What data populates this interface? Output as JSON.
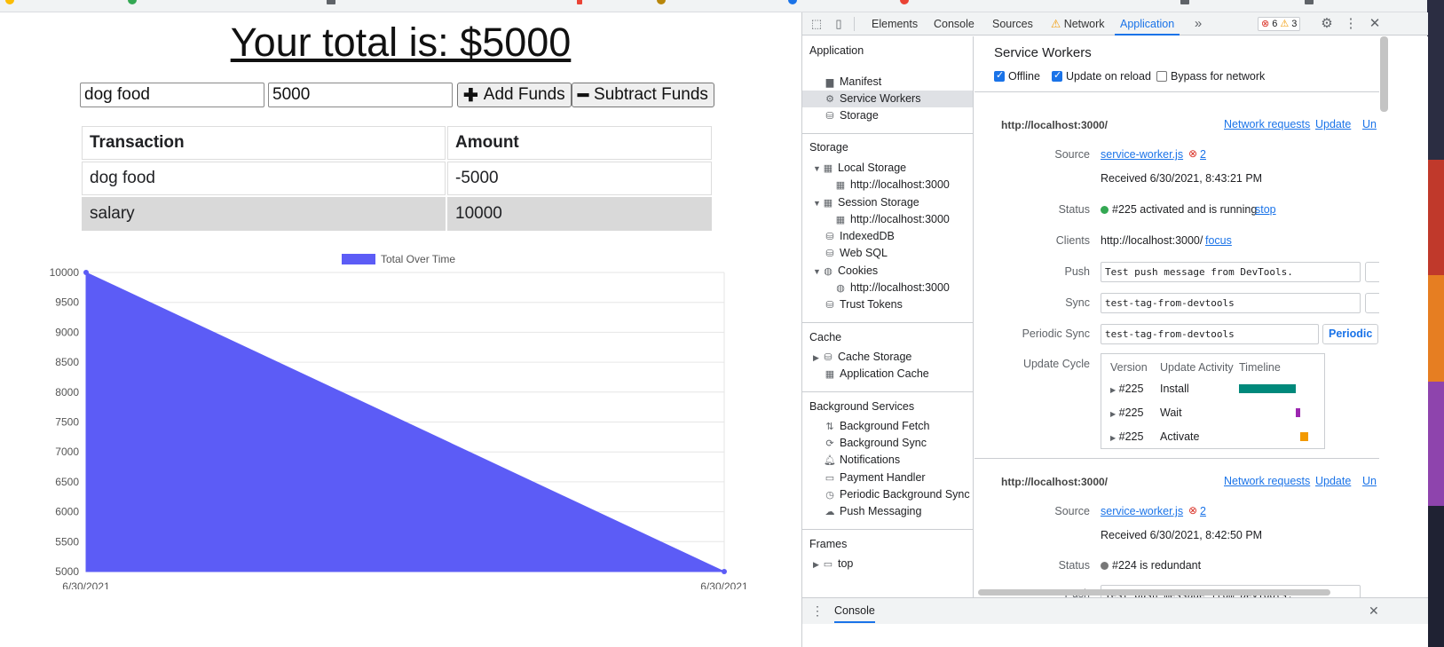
{
  "app": {
    "total_label": "Your total is: $5000",
    "name_input": "dog food",
    "amount_input": "5000",
    "add_button": "Add Funds",
    "subtract_button": "Subtract Funds",
    "table": {
      "headers": [
        "Transaction",
        "Amount"
      ],
      "rows": [
        {
          "name": "dog food",
          "amount": "-5000"
        },
        {
          "name": "salary",
          "amount": "10000"
        }
      ]
    }
  },
  "chart_data": {
    "type": "area",
    "legend": "Total Over Time",
    "legend_position": "top",
    "color": "#5c5cf6",
    "categories": [
      "6/30/2021",
      "6/30/2021"
    ],
    "values": [
      10000,
      5000
    ],
    "ylim": [
      5000,
      10000
    ],
    "yticks": [
      10000,
      9500,
      9000,
      8500,
      8000,
      7500,
      7000,
      6500,
      6000,
      5500,
      5000
    ],
    "grid": true
  },
  "devtools": {
    "tabs": [
      "Elements",
      "Console",
      "Sources",
      "Network",
      "Application"
    ],
    "active_tab": "Application",
    "error_count": "6",
    "warning_count": "3",
    "sidebar": {
      "application_header": "Application",
      "application_items": [
        "Manifest",
        "Service Workers",
        "Storage"
      ],
      "storage_header": "Storage",
      "local_storage": "Local Storage",
      "session_storage": "Session Storage",
      "localhost": "http://localhost:3000",
      "indexeddb": "IndexedDB",
      "websql": "Web SQL",
      "cookies": "Cookies",
      "trust_tokens": "Trust Tokens",
      "cache_header": "Cache",
      "cache_storage": "Cache Storage",
      "application_cache": "Application Cache",
      "bg_header": "Background Services",
      "bg_items": [
        "Background Fetch",
        "Background Sync",
        "Notifications",
        "Payment Handler",
        "Periodic Background Sync",
        "Push Messaging"
      ],
      "frames_header": "Frames",
      "frames_top": "top"
    },
    "sw": {
      "title": "Service Workers",
      "offline": "Offline",
      "update_on_reload": "Update on reload",
      "bypass": "Bypass for network",
      "origin": "http://localhost:3000/",
      "network_requests": "Network requests",
      "update": "Update",
      "unregister": "Un",
      "labels": {
        "source": "Source",
        "status": "Status",
        "clients": "Clients",
        "push": "Push",
        "sync": "Sync",
        "periodic_sync": "Periodic Sync",
        "update_cycle": "Update Cycle"
      },
      "source_file": "service-worker.js",
      "source_errors": "2",
      "received_1": "Received 6/30/2021, 8:43:21 PM",
      "status_1": "#225 activated and is running",
      "stop": "stop",
      "client_url": "http://localhost:3000/",
      "focus": "focus",
      "push_value": "Test push message from DevTools.",
      "sync_value": "test-tag-from-devtools",
      "periodic_value": "test-tag-from-devtools",
      "periodic_button": "Periodic",
      "update_headers": [
        "Version",
        "Update Activity",
        "Timeline"
      ],
      "update_rows": [
        {
          "version": "#225",
          "activity": "Install",
          "color": "#00897b"
        },
        {
          "version": "#225",
          "activity": "Wait",
          "color": "#9c27b0"
        },
        {
          "version": "#225",
          "activity": "Activate",
          "color": "#f29900"
        }
      ],
      "received_2": "Received 6/30/2021, 8:42:50 PM",
      "status_2": "#224 is redundant",
      "push_value_2": "Test push message from DevTools."
    },
    "drawer_tab": "Console",
    "colors": {
      "accent": "#1a73e8",
      "running": "#34a853",
      "redundant": "#777777"
    }
  }
}
